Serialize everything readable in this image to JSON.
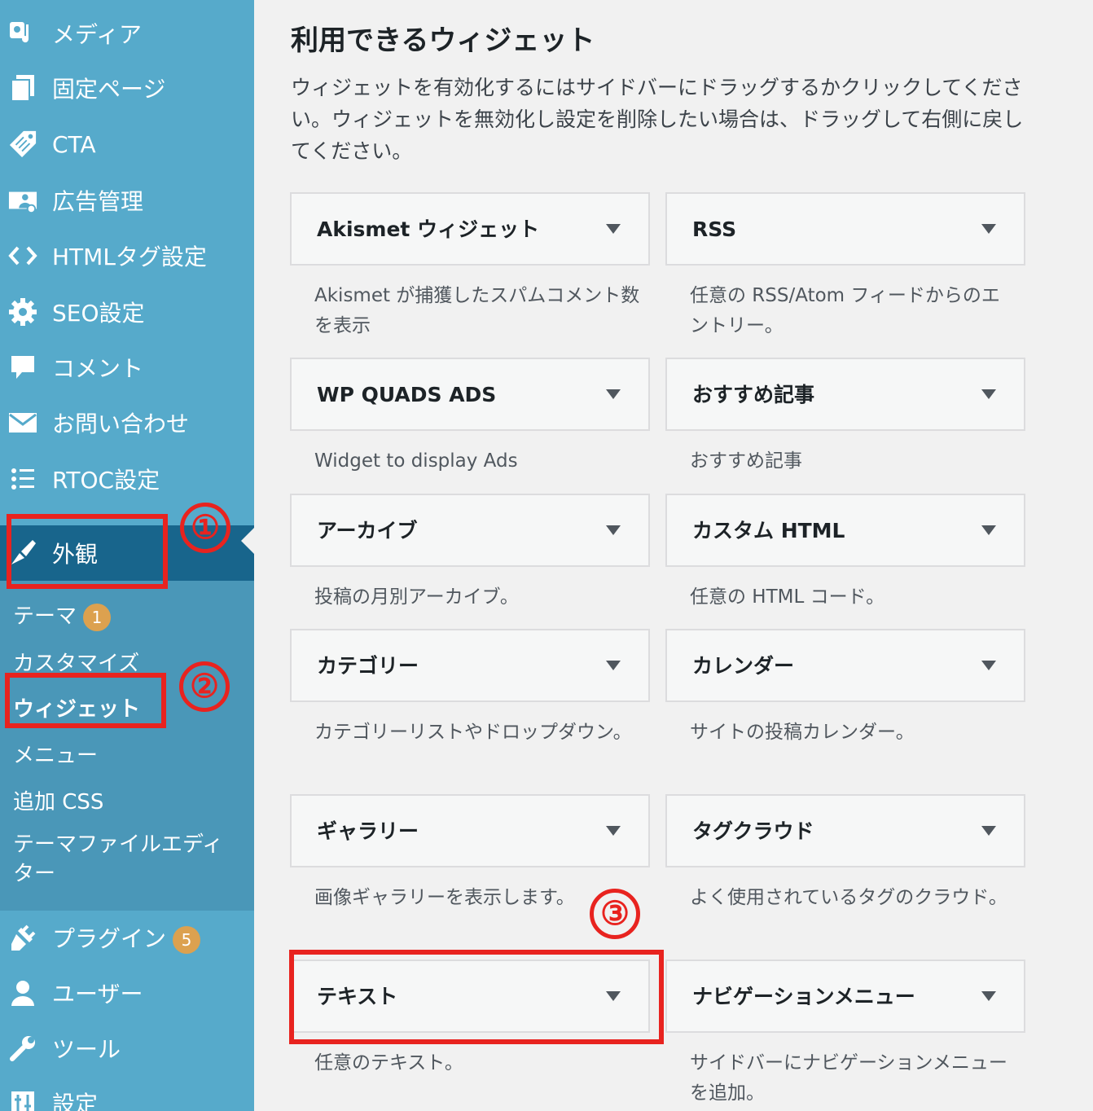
{
  "sidebar": {
    "items": [
      {
        "label": "メディア",
        "icon": "media-icon"
      },
      {
        "label": "固定ページ",
        "icon": "pages-icon"
      },
      {
        "label": "CTA",
        "icon": "tag-icon"
      },
      {
        "label": "広告管理",
        "icon": "ads-icon"
      },
      {
        "label": "HTMLタグ設定",
        "icon": "code-icon"
      },
      {
        "label": "SEO設定",
        "icon": "gear-icon"
      },
      {
        "label": "コメント",
        "icon": "comment-icon"
      },
      {
        "label": "お問い合わせ",
        "icon": "mail-icon"
      },
      {
        "label": "RTOC設定",
        "icon": "list-icon"
      },
      {
        "label": "外観",
        "icon": "brush-icon"
      },
      {
        "label": "プラグイン",
        "icon": "plugin-icon",
        "badge": "5"
      },
      {
        "label": "ユーザー",
        "icon": "user-icon"
      },
      {
        "label": "ツール",
        "icon": "wrench-icon"
      },
      {
        "label": "設定",
        "icon": "settings-icon"
      }
    ],
    "submenu": [
      {
        "label": "テーマ",
        "badge": "1"
      },
      {
        "label": "カスタマイズ"
      },
      {
        "label": "ウィジェット"
      },
      {
        "label": "メニュー"
      },
      {
        "label": "追加 CSS"
      },
      {
        "label": "テーマファイルエディ",
        "label2": "ター"
      }
    ]
  },
  "annotations": [
    "①",
    "②",
    "③"
  ],
  "main": {
    "title": "利用できるウィジェット",
    "description": "ウィジェットを有効化するにはサイドバーにドラッグするかクリックしてください。ウィジェットを無効化し設定を削除したい場合は、ドラッグして右側に戻してください。",
    "widgets": [
      {
        "title": "Akismet ウィジェット",
        "desc": "Akismet が捕獲したスパムコメント数を表示"
      },
      {
        "title": "RSS",
        "desc": "任意の RSS/Atom フィードからのエントリー。"
      },
      {
        "title": "WP QUADS ADS",
        "desc": "Widget to display Ads"
      },
      {
        "title": "おすすめ記事",
        "desc": "おすすめ記事"
      },
      {
        "title": "アーカイブ",
        "desc": "投稿の月別アーカイブ。"
      },
      {
        "title": "カスタム HTML",
        "desc": "任意の HTML コード。"
      },
      {
        "title": "カテゴリー",
        "desc": "カテゴリーリストやドロップダウン。"
      },
      {
        "title": "カレンダー",
        "desc": "サイトの投稿カレンダー。"
      },
      {
        "title": "ギャラリー",
        "desc": "画像ギャラリーを表示します。"
      },
      {
        "title": "タグクラウド",
        "desc": "よく使用されているタグのクラウド。"
      },
      {
        "title": "テキスト",
        "desc": "任意のテキスト。"
      },
      {
        "title": "ナビゲーションメニュー",
        "desc": "サイドバーにナビゲーションメニューを追加。"
      }
    ]
  }
}
